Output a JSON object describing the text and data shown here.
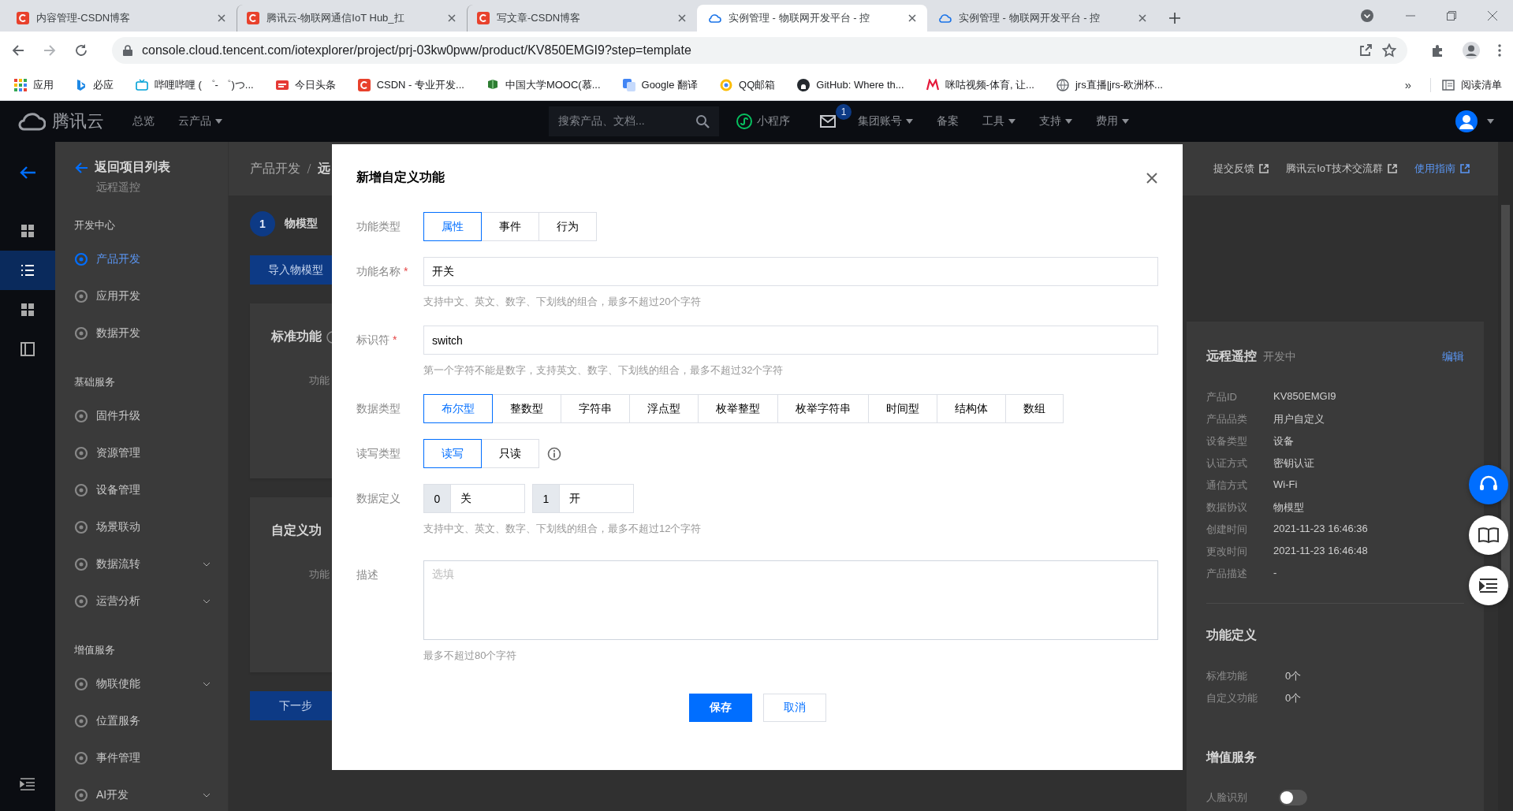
{
  "browser": {
    "tabs": [
      {
        "title": "内容管理-CSDN博客",
        "kind": "csdn",
        "selected": false
      },
      {
        "title": "腾讯云-物联网通信IoT Hub_扛",
        "kind": "csdn",
        "selected": false
      },
      {
        "title": "写文章-CSDN博客",
        "kind": "csdn",
        "selected": false
      },
      {
        "title": "实例管理 - 物联网开发平台 - 控",
        "kind": "cloud",
        "selected": true
      },
      {
        "title": "实例管理 - 物联网开发平台 - 控",
        "kind": "cloud",
        "selected": false
      }
    ],
    "url": "console.cloud.tencent.com/iotexplorer/project/prj-03kw0pww/product/KV850EMGI9?step=template",
    "bookmarks": [
      {
        "label": "应用",
        "kind": "apps"
      },
      {
        "label": "必应",
        "kind": "bing"
      },
      {
        "label": "哔哩哔哩 ( ゜- ゜)つ...",
        "kind": "tv"
      },
      {
        "label": "今日头条",
        "kind": "news"
      },
      {
        "label": "CSDN - 专业开发...",
        "kind": "csdn"
      },
      {
        "label": "中国大学MOOC(慕...",
        "kind": "mooc"
      },
      {
        "label": "Google 翻译",
        "kind": "translate"
      },
      {
        "label": "QQ邮箱",
        "kind": "mail"
      },
      {
        "label": "GitHub: Where th...",
        "kind": "github"
      },
      {
        "label": "咪咕视频-体育, 让...",
        "kind": "migu"
      },
      {
        "label": "jrs直播|jrs-欧洲杯...",
        "kind": "globe"
      }
    ],
    "overflow": "»",
    "reading_list": "阅读清单"
  },
  "console": {
    "logo": "腾讯云",
    "nav": [
      {
        "label": "总览",
        "dropdown": false
      },
      {
        "label": "云产品",
        "dropdown": true
      }
    ],
    "search": {
      "placeholder": "搜索产品、文档..."
    },
    "mini_program": "小程序",
    "mail_badge": "1",
    "nav_right": [
      {
        "label": "集团账号",
        "dropdown": true
      },
      {
        "label": "备案",
        "dropdown": false
      },
      {
        "label": "工具",
        "dropdown": true
      },
      {
        "label": "支持",
        "dropdown": true
      },
      {
        "label": "费用",
        "dropdown": true
      }
    ],
    "rail": [
      {
        "kind": "grid",
        "selected": false
      },
      {
        "kind": "list",
        "selected": true
      },
      {
        "kind": "grid",
        "selected": false
      },
      {
        "kind": "panel",
        "selected": false
      }
    ],
    "sidebar": {
      "back": "返回项目列表",
      "subtitle": "远程遥控",
      "sections": [
        {
          "title": "开发中心",
          "items": [
            {
              "label": "产品开发",
              "selected": true,
              "expandable": false
            },
            {
              "label": "应用开发",
              "selected": false,
              "expandable": false
            },
            {
              "label": "数据开发",
              "selected": false,
              "expandable": false
            }
          ]
        },
        {
          "title": "基础服务",
          "items": [
            {
              "label": "固件升级",
              "selected": false,
              "expandable": false
            },
            {
              "label": "资源管理",
              "selected": false,
              "expandable": false
            },
            {
              "label": "设备管理",
              "selected": false,
              "expandable": false
            },
            {
              "label": "场景联动",
              "selected": false,
              "expandable": false
            },
            {
              "label": "数据流转",
              "selected": false,
              "expandable": true
            },
            {
              "label": "运营分析",
              "selected": false,
              "expandable": true
            }
          ]
        },
        {
          "title": "增值服务",
          "items": [
            {
              "label": "物联使能",
              "selected": false,
              "expandable": true
            },
            {
              "label": "位置服务",
              "selected": false,
              "expandable": false
            },
            {
              "label": "事件管理",
              "selected": false,
              "expandable": false
            },
            {
              "label": "AI开发",
              "selected": false,
              "expandable": true
            }
          ]
        }
      ]
    },
    "breadcrumb": [
      "产品开发",
      "远"
    ],
    "links": [
      {
        "label": "提交反馈",
        "accent": false
      },
      {
        "label": "腾讯云IoT技术交流群",
        "accent": false
      },
      {
        "label": "使用指南",
        "accent": true
      }
    ],
    "step": {
      "number": "1",
      "label": "物模型"
    },
    "import_button": "导入物模型",
    "cards": [
      {
        "title": "标准功能",
        "info": true,
        "column_1": "功能"
      },
      {
        "title": "自定义功",
        "info": false,
        "column_1": "功能"
      }
    ],
    "next_button": "下一步",
    "product": {
      "name": "远程遥控",
      "status": "开发中",
      "edit": "编辑",
      "fields": [
        {
          "label": "产品ID",
          "value": "KV850EMGI9"
        },
        {
          "label": "产品品类",
          "value": "用户自定义"
        },
        {
          "label": "设备类型",
          "value": "设备"
        },
        {
          "label": "认证方式",
          "value": "密钥认证"
        },
        {
          "label": "通信方式",
          "value": "Wi-Fi"
        },
        {
          "label": "数据协议",
          "value": "物模型"
        },
        {
          "label": "创建时间",
          "value": "2021-11-23 16:46:36"
        },
        {
          "label": "更改时间",
          "value": "2021-11-23 16:46:48"
        },
        {
          "label": "产品描述",
          "value": "-"
        }
      ],
      "functions_title": "功能定义",
      "functions": [
        {
          "label": "标准功能",
          "value": "0个"
        },
        {
          "label": "自定义功能",
          "value": "0个"
        }
      ],
      "services_title": "增值服务",
      "services": [
        {
          "label": "人脸识别",
          "on": false
        }
      ]
    }
  },
  "dialog": {
    "title": "新增自定义功能",
    "fields": [
      {
        "kind": "segmented",
        "label": "功能类型",
        "options": [
          {
            "label": "属性",
            "selected": true
          },
          {
            "label": "事件",
            "selected": false
          },
          {
            "label": "行为",
            "selected": false
          }
        ]
      },
      {
        "kind": "input",
        "label": "功能名称",
        "mark": "*",
        "value": "开关",
        "hint": "支持中文、英文、数字、下划线的组合，最多不超过20个字符"
      },
      {
        "kind": "input",
        "label": "标识符",
        "mark": "*",
        "value": "switch",
        "hint": "第一个字符不能是数字，支持英文、数字、下划线的组合，最多不超过32个字符"
      },
      {
        "kind": "segmented",
        "label": "数据类型",
        "options": [
          {
            "label": "布尔型",
            "selected": true
          },
          {
            "label": "整数型",
            "selected": false
          },
          {
            "label": "字符串",
            "selected": false
          },
          {
            "label": "浮点型",
            "selected": false
          },
          {
            "label": "枚举整型",
            "selected": false
          },
          {
            "label": "枚举字符串",
            "selected": false
          },
          {
            "label": "时间型",
            "selected": false
          },
          {
            "label": "结构体",
            "selected": false
          },
          {
            "label": "数组",
            "selected": false
          }
        ]
      },
      {
        "kind": "segmented",
        "label": "读写类型",
        "info": true,
        "options": [
          {
            "label": "读写",
            "selected": true
          },
          {
            "label": "只读",
            "selected": false
          }
        ]
      },
      {
        "kind": "pairs",
        "label": "数据定义",
        "pairs": [
          {
            "key": "0",
            "value": "关"
          },
          {
            "key": "1",
            "value": "开"
          }
        ],
        "hint": "支持中文、英文、数字、下划线的组合，最多不超过12个字符"
      },
      {
        "kind": "textarea",
        "label": "描述",
        "placeholder": "选填",
        "hint": "最多不超过80个字符"
      }
    ],
    "buttons": [
      {
        "label": "保存",
        "primary": true
      },
      {
        "label": "取消",
        "primary": false
      }
    ]
  }
}
